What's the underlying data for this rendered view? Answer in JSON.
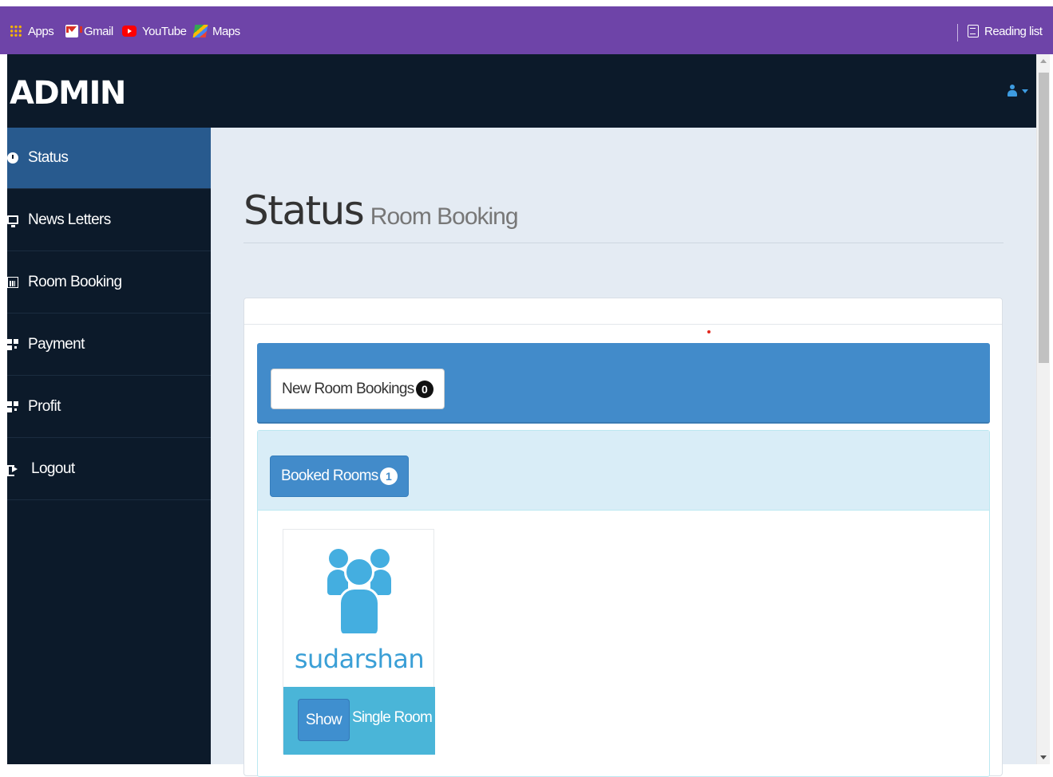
{
  "bookmarks": {
    "items": [
      {
        "label": "Apps",
        "icon": "apps-grid-icon"
      },
      {
        "label": "Gmail",
        "icon": "gmail-icon"
      },
      {
        "label": "YouTube",
        "icon": "youtube-icon"
      },
      {
        "label": "Maps",
        "icon": "maps-icon"
      }
    ],
    "reading_list": "Reading list"
  },
  "header": {
    "brand": "ADMIN",
    "user_icon": "user-icon",
    "accent_color": "#3d9be0"
  },
  "sidebar": {
    "items": [
      {
        "label": "Status",
        "icon": "dashboard-icon",
        "active": true
      },
      {
        "label": "News Letters",
        "icon": "desktop-icon",
        "active": false
      },
      {
        "label": "Room Booking",
        "icon": "bar-chart-icon",
        "active": false
      },
      {
        "label": "Payment",
        "icon": "qrcode-icon",
        "active": false
      },
      {
        "label": "Profit",
        "icon": "qrcode-icon",
        "active": false
      },
      {
        "label": "Logout",
        "icon": "sign-out-icon",
        "active": false
      }
    ]
  },
  "main": {
    "title": "Status",
    "subtitle": "Room Booking",
    "new_bookings": {
      "label": "New Room Bookings",
      "count": "0"
    },
    "booked_rooms": {
      "label": "Booked Rooms",
      "count": "1"
    },
    "cards": [
      {
        "name": "sudarshan",
        "button": "Show",
        "room_type": "Single Room",
        "icon": "users-icon"
      }
    ]
  },
  "colors": {
    "bookmark_bar": "#6e44a8",
    "nav_bg": "#0c1a2a",
    "nav_active": "#285a8e",
    "primary": "#428bca",
    "info_bg": "#d9edf7",
    "card_footer": "#4ab5d8"
  }
}
